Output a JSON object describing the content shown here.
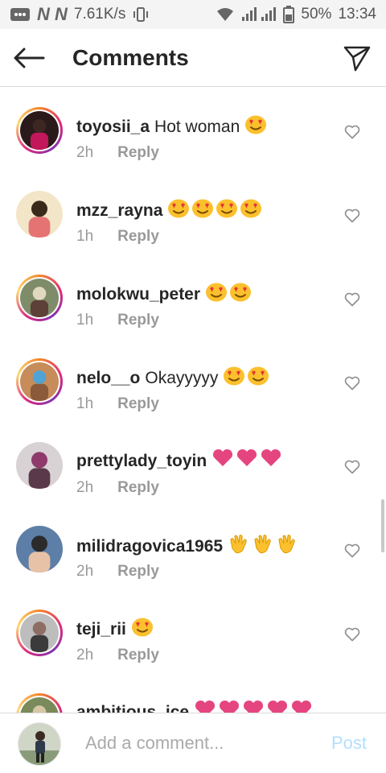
{
  "statusbar": {
    "carrier_marks": "N N",
    "speed": "7.61K/s",
    "battery": "50%",
    "time": "13:34"
  },
  "header": {
    "title": "Comments",
    "back_icon": "arrow-left-icon",
    "send_icon": "paper-plane-icon"
  },
  "comments": [
    {
      "username": "toyosii_a",
      "text": "Hot woman",
      "emoji": "heart-eyes",
      "emoji_count": 1,
      "time": "2h",
      "reply": "Reply",
      "ring": true
    },
    {
      "username": "mzz_rayna",
      "text": "",
      "emoji": "heart-eyes",
      "emoji_count": 4,
      "time": "1h",
      "reply": "Reply",
      "ring": false
    },
    {
      "username": "molokwu_peter",
      "text": "",
      "emoji": "heart-eyes",
      "emoji_count": 2,
      "time": "1h",
      "reply": "Reply",
      "ring": true
    },
    {
      "username": "nelo__o",
      "text": "Okayyyyy",
      "emoji": "heart-eyes",
      "emoji_count": 2,
      "time": "1h",
      "reply": "Reply",
      "ring": true
    },
    {
      "username": "prettylady_toyin",
      "text": "",
      "emoji": "pink-heart",
      "emoji_count": 3,
      "time": "2h",
      "reply": "Reply",
      "ring": false
    },
    {
      "username": "milidragovica1965",
      "text": "",
      "emoji": "clap",
      "emoji_count": 3,
      "time": "2h",
      "reply": "Reply",
      "ring": false
    },
    {
      "username": "teji_rii",
      "text": "",
      "emoji": "heart-eyes",
      "emoji_count": 1,
      "time": "2h",
      "reply": "Reply",
      "ring": true
    },
    {
      "username": "ambitious_ice",
      "text": "",
      "emoji": "pink-heart",
      "emoji_count": 5,
      "time": "",
      "reply": "",
      "ring": true
    }
  ],
  "compose": {
    "placeholder": "Add a comment...",
    "post_label": "Post"
  },
  "colors": {
    "link_disabled": "#b2dffc",
    "meta_gray": "#999999",
    "heart_pink": "#e5457f",
    "emoji_yellow": "#fbc02d"
  }
}
